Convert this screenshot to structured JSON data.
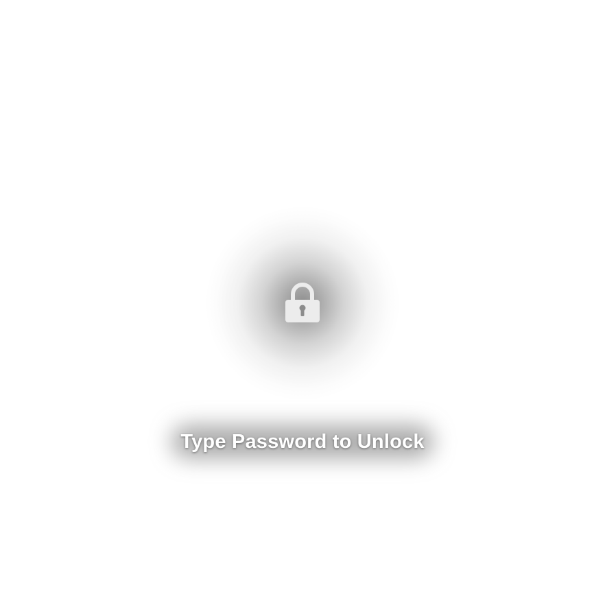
{
  "lock_screen": {
    "prompt": "Type Password to Unlock",
    "icon": "lock-icon",
    "background_color": "#ffffff",
    "text_color": "#ffffff",
    "icon_color": "#ececec"
  }
}
